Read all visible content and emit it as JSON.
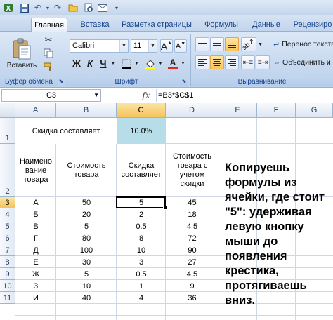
{
  "tabs": [
    "Главная",
    "Вставка",
    "Разметка страницы",
    "Формулы",
    "Данные",
    "Рецензиро"
  ],
  "ribbon": {
    "paste_label": "Вставить",
    "font_name": "Calibri",
    "font_size": "11",
    "bold": "Ж",
    "italic": "К",
    "underline": "Ч",
    "grow_font": "A",
    "shrink_font": "A",
    "font_color_glyph": "A",
    "wrap_text": "Перенос текста",
    "merge_center": "Объединить и",
    "groups": {
      "clipboard": "Буфер обмена",
      "font": "Шрифт",
      "alignment": "Выравнивание"
    }
  },
  "formula_bar": {
    "name_box": "C3",
    "fx": "fx",
    "formula": "=B3*$C$1"
  },
  "columns": [
    "A",
    "B",
    "C",
    "D",
    "E",
    "F",
    "G"
  ],
  "rows": [
    "1",
    "2",
    "3",
    "4",
    "5",
    "6",
    "7",
    "8",
    "9",
    "10",
    "11"
  ],
  "cells": {
    "r1": {
      "a": "Скидка составляет",
      "c": "10.0%"
    },
    "r2": {
      "a": "Наимено вание товара",
      "b": "Стоимость товара",
      "c": "Скидка составляет",
      "d": "Стоимость товара с учетом скидки"
    },
    "data": [
      [
        "А",
        "50",
        "5",
        "45"
      ],
      [
        "Б",
        "20",
        "2",
        "18"
      ],
      [
        "В",
        "5",
        "0.5",
        "4.5"
      ],
      [
        "Г",
        "80",
        "8",
        "72"
      ],
      [
        "Д",
        "100",
        "10",
        "90"
      ],
      [
        "Е",
        "30",
        "3",
        "27"
      ],
      [
        "Ж",
        "5",
        "0.5",
        "4.5"
      ],
      [
        "З",
        "10",
        "1",
        "9"
      ],
      [
        "И",
        "40",
        "4",
        "36"
      ]
    ]
  },
  "note": "Копируешь\nформулы из\nячейки, где стоит\n\"5\": удерживая\nлевую кнопку\nмыши до\nпоявления\nкрестика,\nпротягиваешь\nвниз."
}
